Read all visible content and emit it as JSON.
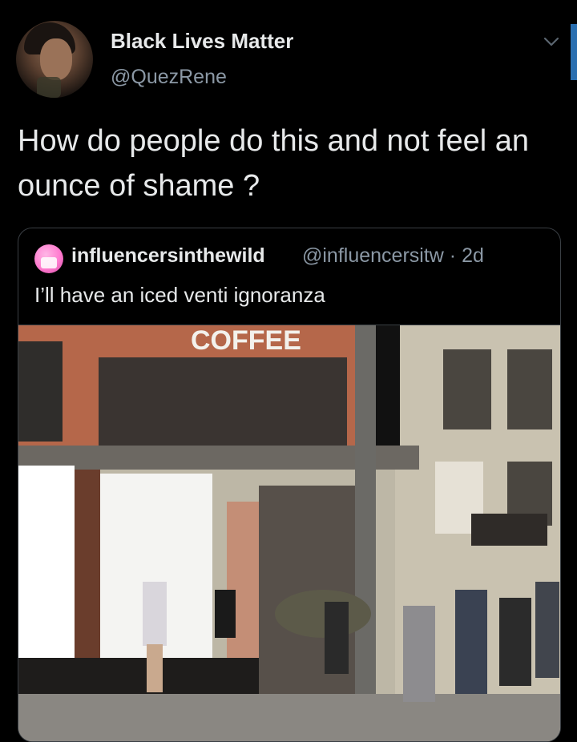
{
  "tweet": {
    "author_name": "Black Lives Matter",
    "author_handle": "@QuezRene",
    "text": "How do people do this and not feel an ounce of shame ?"
  },
  "quoted_tweet": {
    "author_name": "influencersinthewild",
    "author_handle": "@influencersitw",
    "time": "2d",
    "separator": "·",
    "text": "I’ll have an iced venti ignoranza",
    "media": {
      "sign_text": "COFFEE"
    }
  },
  "icons": {
    "more": "chevron-down-icon",
    "avatar": "avatar",
    "quoted_avatar": "avatar"
  },
  "colors": {
    "background": "#000000",
    "primary_text": "#e7e9ea",
    "secondary_text": "#8b98a5",
    "border": "#3a3f44",
    "accent": "#2a6fb0"
  }
}
